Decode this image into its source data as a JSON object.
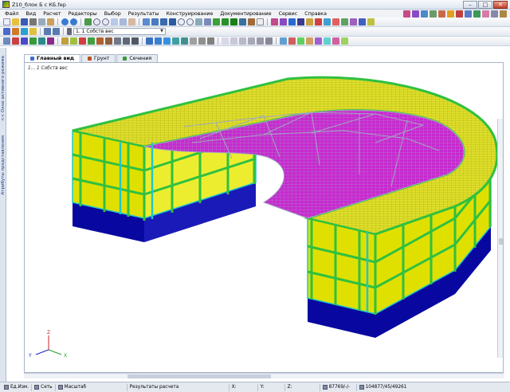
{
  "window": {
    "title": "Z10_блок Б с КБ.fep",
    "minimize_glyph": "–",
    "maximize_glyph": "□",
    "close_glyph": "✕"
  },
  "menu": [
    "Файл",
    "Вид",
    "Расчет",
    "Редакторы",
    "Выбор",
    "Результаты",
    "Конструирование",
    "Документирование",
    "Сервис",
    "Справка"
  ],
  "toolbar": {
    "loadcase_combo": "1. 1 Собств вес"
  },
  "left_panel": {
    "tab1": "<< Окно активного режима",
    "tab2": "Атрибуты представления"
  },
  "tabs": [
    {
      "label": "Главный вид",
      "icon": "main-view-icon",
      "color": "#3a6fcf"
    },
    {
      "label": "Грунт",
      "icon": "soil-icon",
      "color": "#b8501e"
    },
    {
      "label": "Сечения",
      "icon": "section-icon",
      "color": "#3a9a3a"
    }
  ],
  "viewport": {
    "caption": "1... 1 Собств вес",
    "axes": {
      "z": "Z",
      "y": "Y",
      "x": "X"
    }
  },
  "colors": {
    "slab": "#dede2a",
    "walls": "#e0e000",
    "beams": "#30c040",
    "columns": "#20c8c8",
    "roof_beams": "#d020d8",
    "truss": "#a0a8c0",
    "foundation": "#0808a0"
  },
  "statusbar": {
    "cell1": "Ед.Изм.",
    "cell2": "Сеть",
    "cell3": "Масштаб",
    "results": "Результаты расчета",
    "x_label": "X:",
    "y_label": "Y:",
    "z_label": "Z:",
    "counter1": "87769/-/-",
    "counter2": "104877/45/49261"
  }
}
